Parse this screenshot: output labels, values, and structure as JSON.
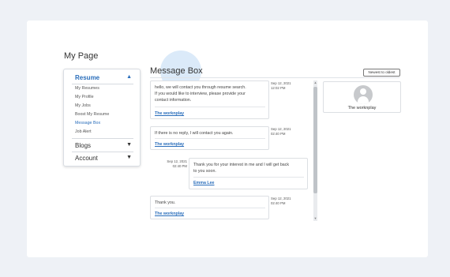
{
  "page": {
    "title": "My Page"
  },
  "sidebar": {
    "resume": {
      "label": "Resume",
      "items": [
        "My Resumes",
        "My Profile",
        "My Jobs",
        "Boost My Resume",
        "Message Box",
        "Job Alert"
      ],
      "active_item": "Message Box"
    },
    "blogs": {
      "label": "Blogs"
    },
    "account": {
      "label": "Account"
    }
  },
  "main": {
    "title": "Message Box",
    "sort_label": "Newest to oldest",
    "messages": [
      {
        "direction": "incoming",
        "text": "hello, we will contact you through resume search.\nIf you would like to interview, please provide your\ncontact information.",
        "sender": "The worknplay",
        "date": "Sep 12, 2021",
        "time": "12:02 PM"
      },
      {
        "direction": "incoming",
        "text": "If there is no reply, I will contact you again.",
        "sender": "The worknplay",
        "date": "Sep 12, 2021",
        "time": "02:40 PM"
      },
      {
        "direction": "outgoing",
        "text": "Thank you for your interest in me and I will get back\nto you soon.",
        "sender": "Emma Lee",
        "date": "Sep 12, 2021",
        "time": "02:40 PM"
      },
      {
        "direction": "incoming",
        "text": "Thank you.",
        "sender": "The worknplay",
        "date": "Sep 12, 2021",
        "time": "02:40 PM"
      }
    ]
  },
  "profile": {
    "name": "The worknplay",
    "avatar_icon": "user-avatar-icon"
  },
  "colors": {
    "accent": "#2a6ebb",
    "background": "#eef1f6",
    "highlight": "#dbeaf9"
  }
}
